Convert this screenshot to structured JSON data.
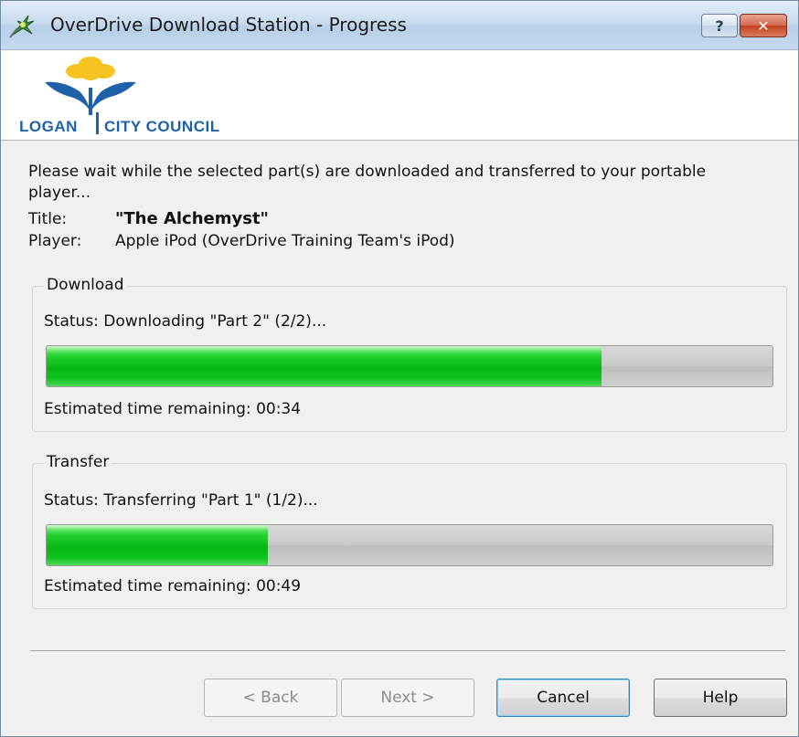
{
  "window": {
    "title": "OverDrive Download Station - Progress",
    "help_glyph": "?",
    "close_glyph": "✕"
  },
  "logo": {
    "left_word": "LOGAN",
    "right_word": "CITY COUNCIL",
    "colors": {
      "blue": "#1d62a8",
      "yellow": "#f6c321"
    }
  },
  "intro": {
    "message": "Please wait while the selected part(s) are downloaded and transferred to your portable player...",
    "title_label": "Title:",
    "title_value": "\"The Alchemyst\"",
    "player_label": "Player:",
    "player_value": "Apple iPod (OverDrive Training Team's iPod)"
  },
  "download": {
    "group_label": "Download",
    "status": "Status: Downloading \"Part 2\" (2/2)...",
    "progress": 0.765,
    "eta": "Estimated time remaining: 00:34"
  },
  "transfer": {
    "group_label": "Transfer",
    "status": "Status: Transferring \"Part 1\" (1/2)...",
    "progress": 0.305,
    "eta": "Estimated time remaining: 00:49"
  },
  "buttons": {
    "back": "< Back",
    "next": "Next >",
    "cancel": "Cancel",
    "help": "Help"
  },
  "colors": {
    "progress_green": "#06b714",
    "titlebar": "#c8dbef"
  }
}
